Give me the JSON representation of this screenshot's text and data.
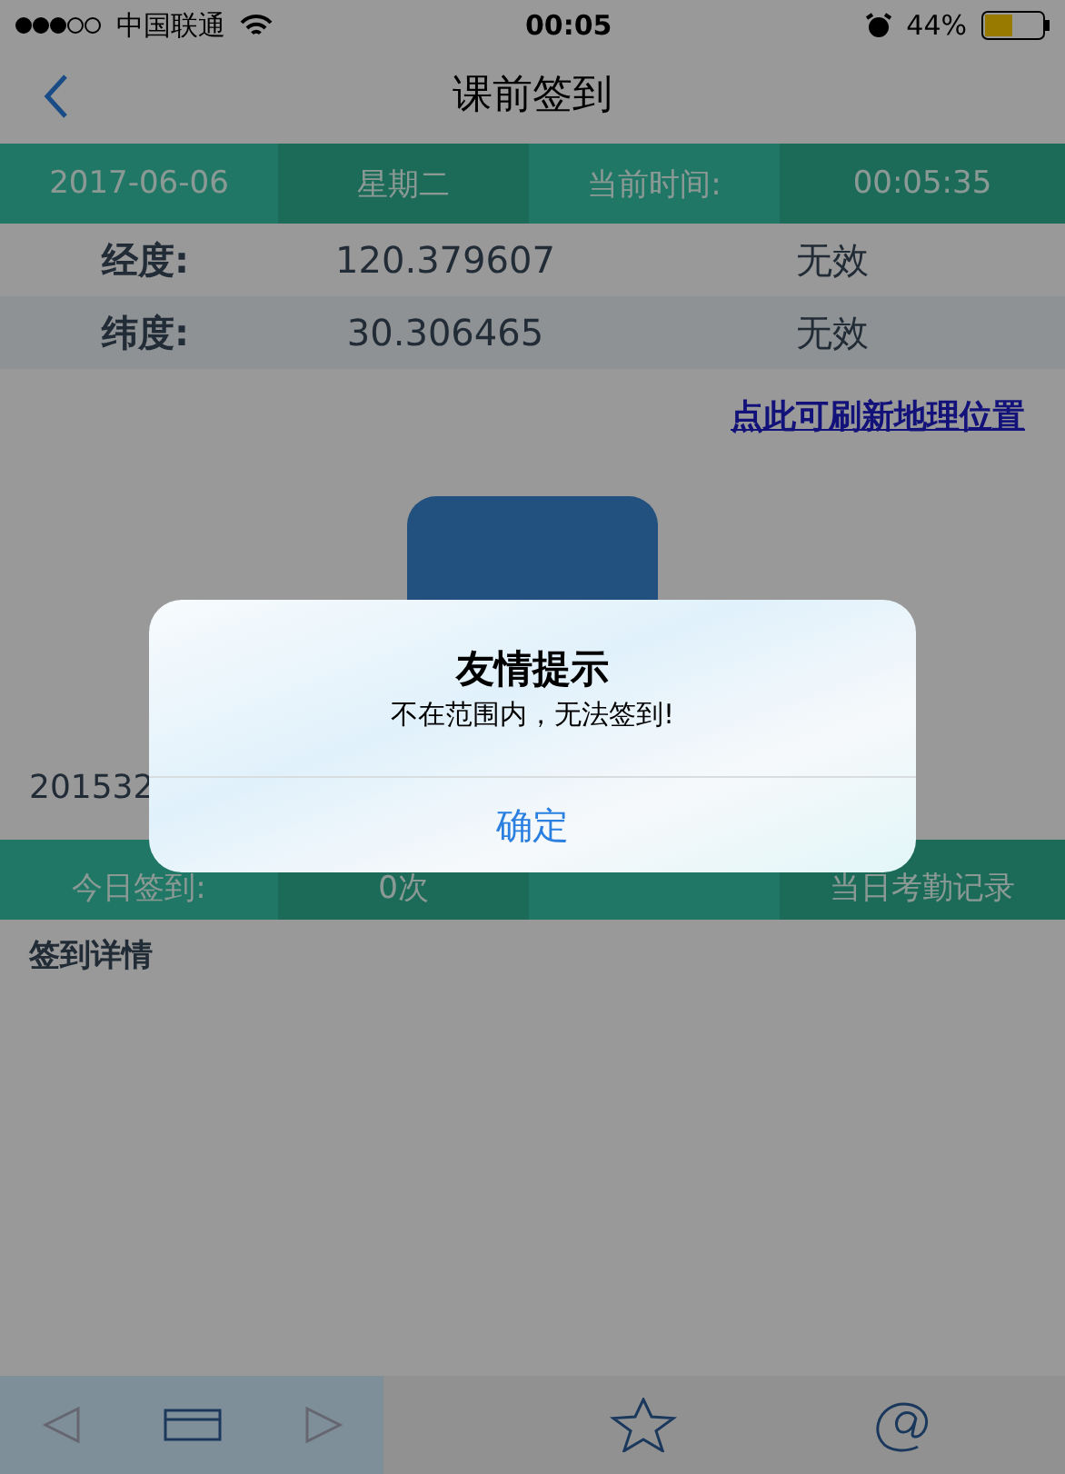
{
  "status_bar": {
    "carrier": "中国联通",
    "time": "00:05",
    "battery": "44%"
  },
  "nav": {
    "title": "课前签到"
  },
  "info_bar": [
    "2017-06-06",
    "星期二",
    "当前时间:",
    "00:05:35"
  ],
  "coords": [
    {
      "label": "经度:",
      "value": "120.379607",
      "status": "无效"
    },
    {
      "label": "纬度:",
      "value": "30.306465",
      "status": "无效"
    }
  ],
  "refresh_link": "点此可刷新地理位置",
  "student_id": "201532",
  "today_bar": {
    "label": "今日签到:",
    "count": "0次",
    "records": "当日考勤记录"
  },
  "details_title": "签到详情",
  "alert": {
    "title": "友情提示",
    "message": "不在范围内，无法签到!",
    "button": "确定"
  }
}
